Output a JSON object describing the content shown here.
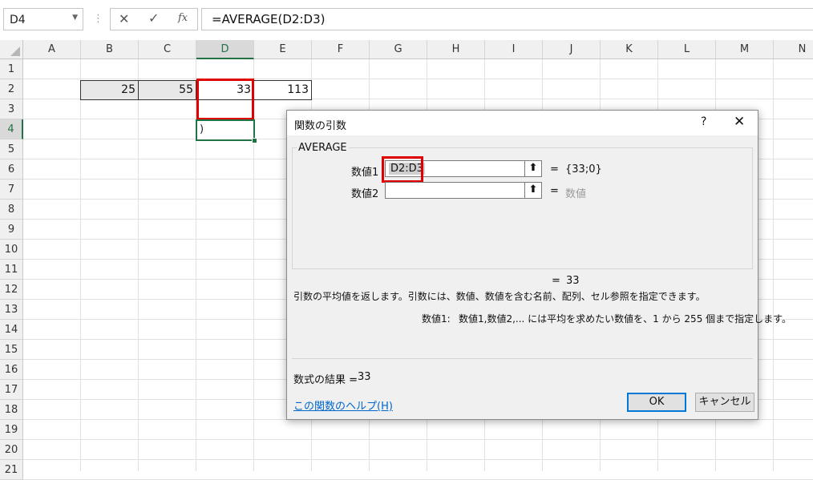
{
  "name_box": {
    "value": "D4"
  },
  "formula_bar": {
    "cancel_icon": "✕",
    "enter_icon": "✓",
    "fx_label": "fx",
    "separator": "⋮",
    "formula": "=AVERAGE(D2:D3)"
  },
  "columns": [
    "A",
    "B",
    "C",
    "D",
    "E",
    "F",
    "G",
    "H",
    "I",
    "J",
    "K",
    "L",
    "M",
    "N"
  ],
  "active_column": "D",
  "rows": [
    "1",
    "2",
    "3",
    "4",
    "5",
    "6",
    "7",
    "8",
    "9",
    "10",
    "11",
    "12",
    "13",
    "14",
    "15",
    "16",
    "17",
    "18",
    "19",
    "20",
    "21"
  ],
  "active_row": "4",
  "cells": {
    "B2": "25",
    "C2": "55",
    "D2": "33",
    "E2": "113",
    "D4": ")"
  },
  "dialog": {
    "title": "関数の引数",
    "help_icon": "?",
    "close_icon": "✕",
    "function_name": "AVERAGE",
    "args": [
      {
        "label": "数値1",
        "value": "D2:D3",
        "eq": "=",
        "result": "{33;0}"
      },
      {
        "label": "数値2",
        "value": "",
        "eq": "=",
        "result": "数値"
      }
    ],
    "collapse_icon": "⬆",
    "result_eq": "=",
    "result_value": "33",
    "description": "引数の平均値を返します。引数には、数値、数値を含む名前、配列、セル参照を指定できます。",
    "arg_desc_label": "数値1:",
    "arg_desc_text": "数値1,数値2,... には平均を求めたい数値を、1 から 255 個まで指定します。",
    "formula_result_label": "数式の結果 =",
    "formula_result_value": "33",
    "help_link": "この関数のヘルプ(H)",
    "ok_label": "OK",
    "cancel_label": "キャンセル"
  },
  "colors": {
    "excel_green": "#217346",
    "highlight_red": "#e00000",
    "link_blue": "#0066cc"
  }
}
